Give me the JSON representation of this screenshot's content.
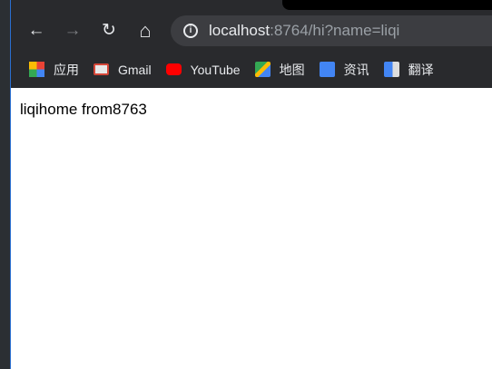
{
  "toolbar": {
    "back": "←",
    "forward": "→",
    "reload": "↻",
    "home": "⌂"
  },
  "address": {
    "host": "localhost",
    "rest": ":8764/hi?name=liqi"
  },
  "bookmarks": [
    {
      "label": "应用",
      "icon": "apps-grid-icon"
    },
    {
      "label": "Gmail",
      "icon": "gmail-icon"
    },
    {
      "label": "YouTube",
      "icon": "youtube-icon"
    },
    {
      "label": "地图",
      "icon": "maps-icon"
    },
    {
      "label": "资讯",
      "icon": "news-icon"
    },
    {
      "label": "翻译",
      "icon": "translate-icon"
    }
  ],
  "page": {
    "text": "liqihome from8763"
  }
}
